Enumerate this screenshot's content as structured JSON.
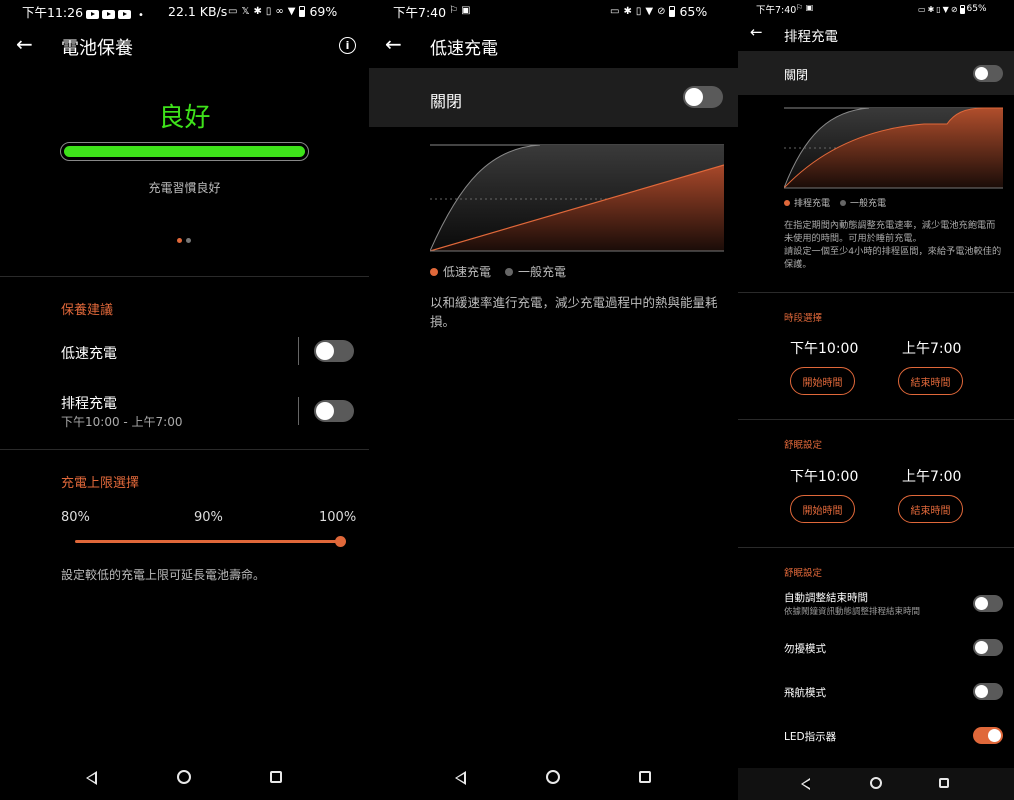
{
  "panel1": {
    "status": {
      "time": "下午11:26",
      "speed": "22.1 KB/s",
      "battery": "69%"
    },
    "title": "電池保養",
    "status_word": "良好",
    "status_desc": "充電習慣良好",
    "care_section": "保養建議",
    "slow_charge_label": "低速充電",
    "slow_charge_on": false,
    "scheduled_label": "排程充電",
    "scheduled_sub": "下午10:00 - 上午7:00",
    "scheduled_on": false,
    "limit_section": "充電上限選擇",
    "limit_options": [
      "80%",
      "90%",
      "100%"
    ],
    "limit_value": 100,
    "limit_desc": "設定較低的充電上限可延長電池壽命。",
    "health_fill_fraction": 1.0,
    "accent": "#e0683a",
    "good_color": "#3ee21a"
  },
  "panel2": {
    "status": {
      "time": "下午7:40",
      "battery": "65%"
    },
    "title": "低速充電",
    "toggle_label": "關閉",
    "toggle_on": false,
    "legend_a": "低速充電",
    "legend_b": "一般充電",
    "desc": "以和緩速率進行充電，減少充電過程中的熱與能量耗損。"
  },
  "panel3": {
    "status": {
      "time": "下午7:40",
      "battery": "65%"
    },
    "title": "排程充電",
    "toggle_label": "關閉",
    "toggle_on": false,
    "legend_a": "排程充電",
    "legend_b": "一般充電",
    "desc": "在指定期間內動態調整充電速率，減少電池充飽電而未使用的時間。可用於睡前充電。\n請設定一個至少4小時的排程區間，來給予電池較佳的保護。",
    "period_section": "時段選擇",
    "period_start": "下午10:00",
    "period_end": "上午7:00",
    "start_btn": "開始時間",
    "end_btn": "結束時間",
    "sleep_section": "舒眠設定",
    "sleep_start": "下午10:00",
    "sleep_end": "上午7:00",
    "sleep_start_btn": "開始時間",
    "sleep_end_btn": "結束時間",
    "sleep_section2": "舒眠設定",
    "auto_label": "自動調整結束時間",
    "auto_sub": "依據鬧鐘資訊動態調整排程結束時間",
    "auto_on": false,
    "dnd_label": "勿擾模式",
    "dnd_on": false,
    "airplane_label": "飛航模式",
    "airplane_on": false,
    "led_label": "LED指示器",
    "led_on": true
  }
}
